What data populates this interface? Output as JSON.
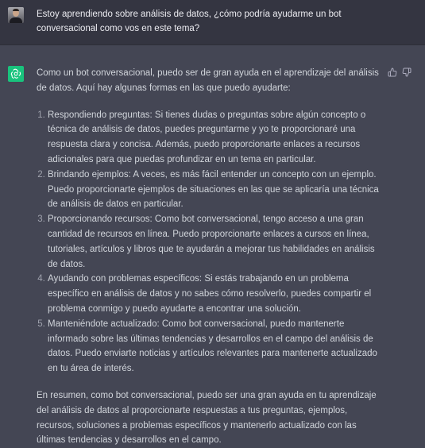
{
  "user_message": "Estoy aprendiendo sobre análisis de datos, ¿cómo podría ayudarme un bot conversacional como vos en este tema?",
  "assistant": {
    "intro": "Como un bot conversacional, puedo ser de gran ayuda en el aprendizaje del análisis de datos. Aquí hay algunas formas en las que puedo ayudarte:",
    "items": [
      "Respondiendo preguntas: Si tienes dudas o preguntas sobre algún concepto o técnica de análisis de datos, puedes preguntarme y yo te proporcionaré una respuesta clara y concisa. Además, puedo proporcionarte enlaces a recursos adicionales para que puedas profundizar en un tema en particular.",
      "Brindando ejemplos: A veces, es más fácil entender un concepto con un ejemplo. Puedo proporcionarte ejemplos de situaciones en las que se aplicaría una técnica de análisis de datos en particular.",
      "Proporcionando recursos: Como bot conversacional, tengo acceso a una gran cantidad de recursos en línea. Puedo proporcionarte enlaces a cursos en línea, tutoriales, artículos y libros que te ayudarán a mejorar tus habilidades en análisis de datos.",
      "Ayudando con problemas específicos: Si estás trabajando en un problema específico en análisis de datos y no sabes cómo resolverlo, puedes compartir el problema conmigo y puedo ayudarte a encontrar una solución.",
      "Manteniéndote actualizado: Como bot conversacional, puedo mantenerte informado sobre las últimas tendencias y desarrollos en el campo del análisis de datos. Puedo enviarte noticias y artículos relevantes para mantenerte actualizado en tu área de interés."
    ],
    "conclusion": "En resumen, como bot conversacional, puedo ser una gran ayuda en tu aprendizaje del análisis de datos al proporcionarte respuestas a tus preguntas, ejemplos, recursos, soluciones a problemas específicos y mantenerlo actualizado con las últimas tendencias y desarrollos en el campo."
  },
  "icons": {
    "user_avatar": "user-avatar",
    "bot_avatar": "openai-logo-icon",
    "thumbs_up": "thumbs-up-icon",
    "thumbs_down": "thumbs-down-icon"
  },
  "colors": {
    "user_row_bg": "#343541",
    "assistant_row_bg": "#444654",
    "bot_avatar_bg": "#19c37d"
  }
}
